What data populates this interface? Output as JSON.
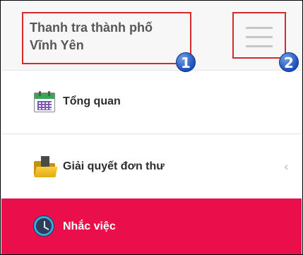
{
  "header": {
    "title_line1": "Thanh tra thành phố",
    "title_line2": "Vĩnh Yên",
    "callout_1": "1",
    "callout_2": "2"
  },
  "menu": {
    "items": [
      {
        "label": "Tổng quan",
        "icon": "calendar-icon"
      },
      {
        "label": "Giải quyết đơn thư",
        "icon": "folder-icon",
        "chevron": "‹"
      },
      {
        "label": "Nhắc việc",
        "icon": "alarm-clock-icon",
        "active": true
      }
    ]
  },
  "colors": {
    "highlight_box": "#d42a2a",
    "active_item": "#ea0f4a",
    "callout": "#1c4eb8"
  }
}
